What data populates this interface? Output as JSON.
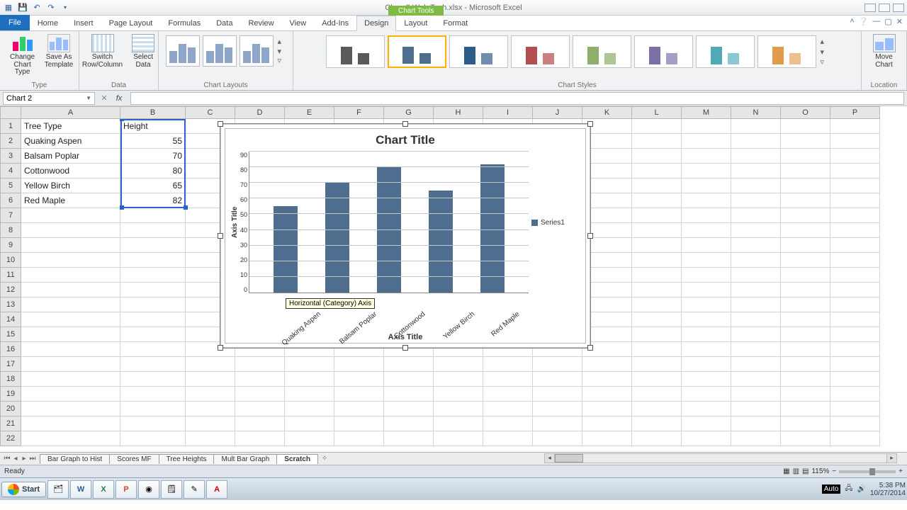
{
  "titlebar": {
    "doc": "Chap 3 Web Tech.xlsx - Microsoft Excel",
    "context": "Chart Tools"
  },
  "tabs": {
    "file": "File",
    "items": [
      "Home",
      "Insert",
      "Page Layout",
      "Formulas",
      "Data",
      "Review",
      "View",
      "Add-Ins",
      "Design",
      "Layout",
      "Format"
    ],
    "active": "Design"
  },
  "ribbon": {
    "type": {
      "title": "Type",
      "change": "Change\nChart Type",
      "saveas": "Save As\nTemplate"
    },
    "data": {
      "title": "Data",
      "switch": "Switch\nRow/Column",
      "select": "Select\nData"
    },
    "layouts": {
      "title": "Chart Layouts"
    },
    "styles": {
      "title": "Chart Styles"
    },
    "location": {
      "title": "Location",
      "move": "Move\nChart"
    }
  },
  "namebox": "Chart 2",
  "columns": [
    "A",
    "B",
    "C",
    "D",
    "E",
    "F",
    "G",
    "H",
    "I",
    "J",
    "K",
    "L",
    "M",
    "N",
    "O",
    "P"
  ],
  "sheet": {
    "a": [
      "Tree Type",
      "Quaking Aspen",
      "Balsam Poplar",
      "Cottonwood",
      "Yellow Birch",
      "Red Maple"
    ],
    "b_header": "Height",
    "b": [
      55,
      70,
      80,
      65,
      82
    ]
  },
  "chart_data": {
    "type": "bar",
    "title": "Chart Title",
    "categories": [
      "Quaking Aspen",
      "Balsam Poplar",
      "Cottonwood",
      "Yellow Birch",
      "Red Maple"
    ],
    "values": [
      55,
      70,
      80,
      65,
      82
    ],
    "series_name": "Series1",
    "xlabel": "Axis Title",
    "ylabel": "Axis Title",
    "ylim": [
      0,
      90
    ],
    "yticks": [
      0,
      10,
      20,
      30,
      40,
      50,
      60,
      70,
      80,
      90
    ]
  },
  "tooltip": "Horizontal (Category) Axis",
  "sheets": {
    "tabs": [
      "Bar Graph to Hist",
      "Scores MF",
      "Tree Heights",
      "Mult Bar Graph",
      "Scratch"
    ],
    "active": "Scratch"
  },
  "status": {
    "ready": "Ready",
    "zoom": "115%"
  },
  "taskbar": {
    "start": "Start",
    "time": "5:38 PM",
    "date": "10/27/2014",
    "auto": "Auto"
  }
}
